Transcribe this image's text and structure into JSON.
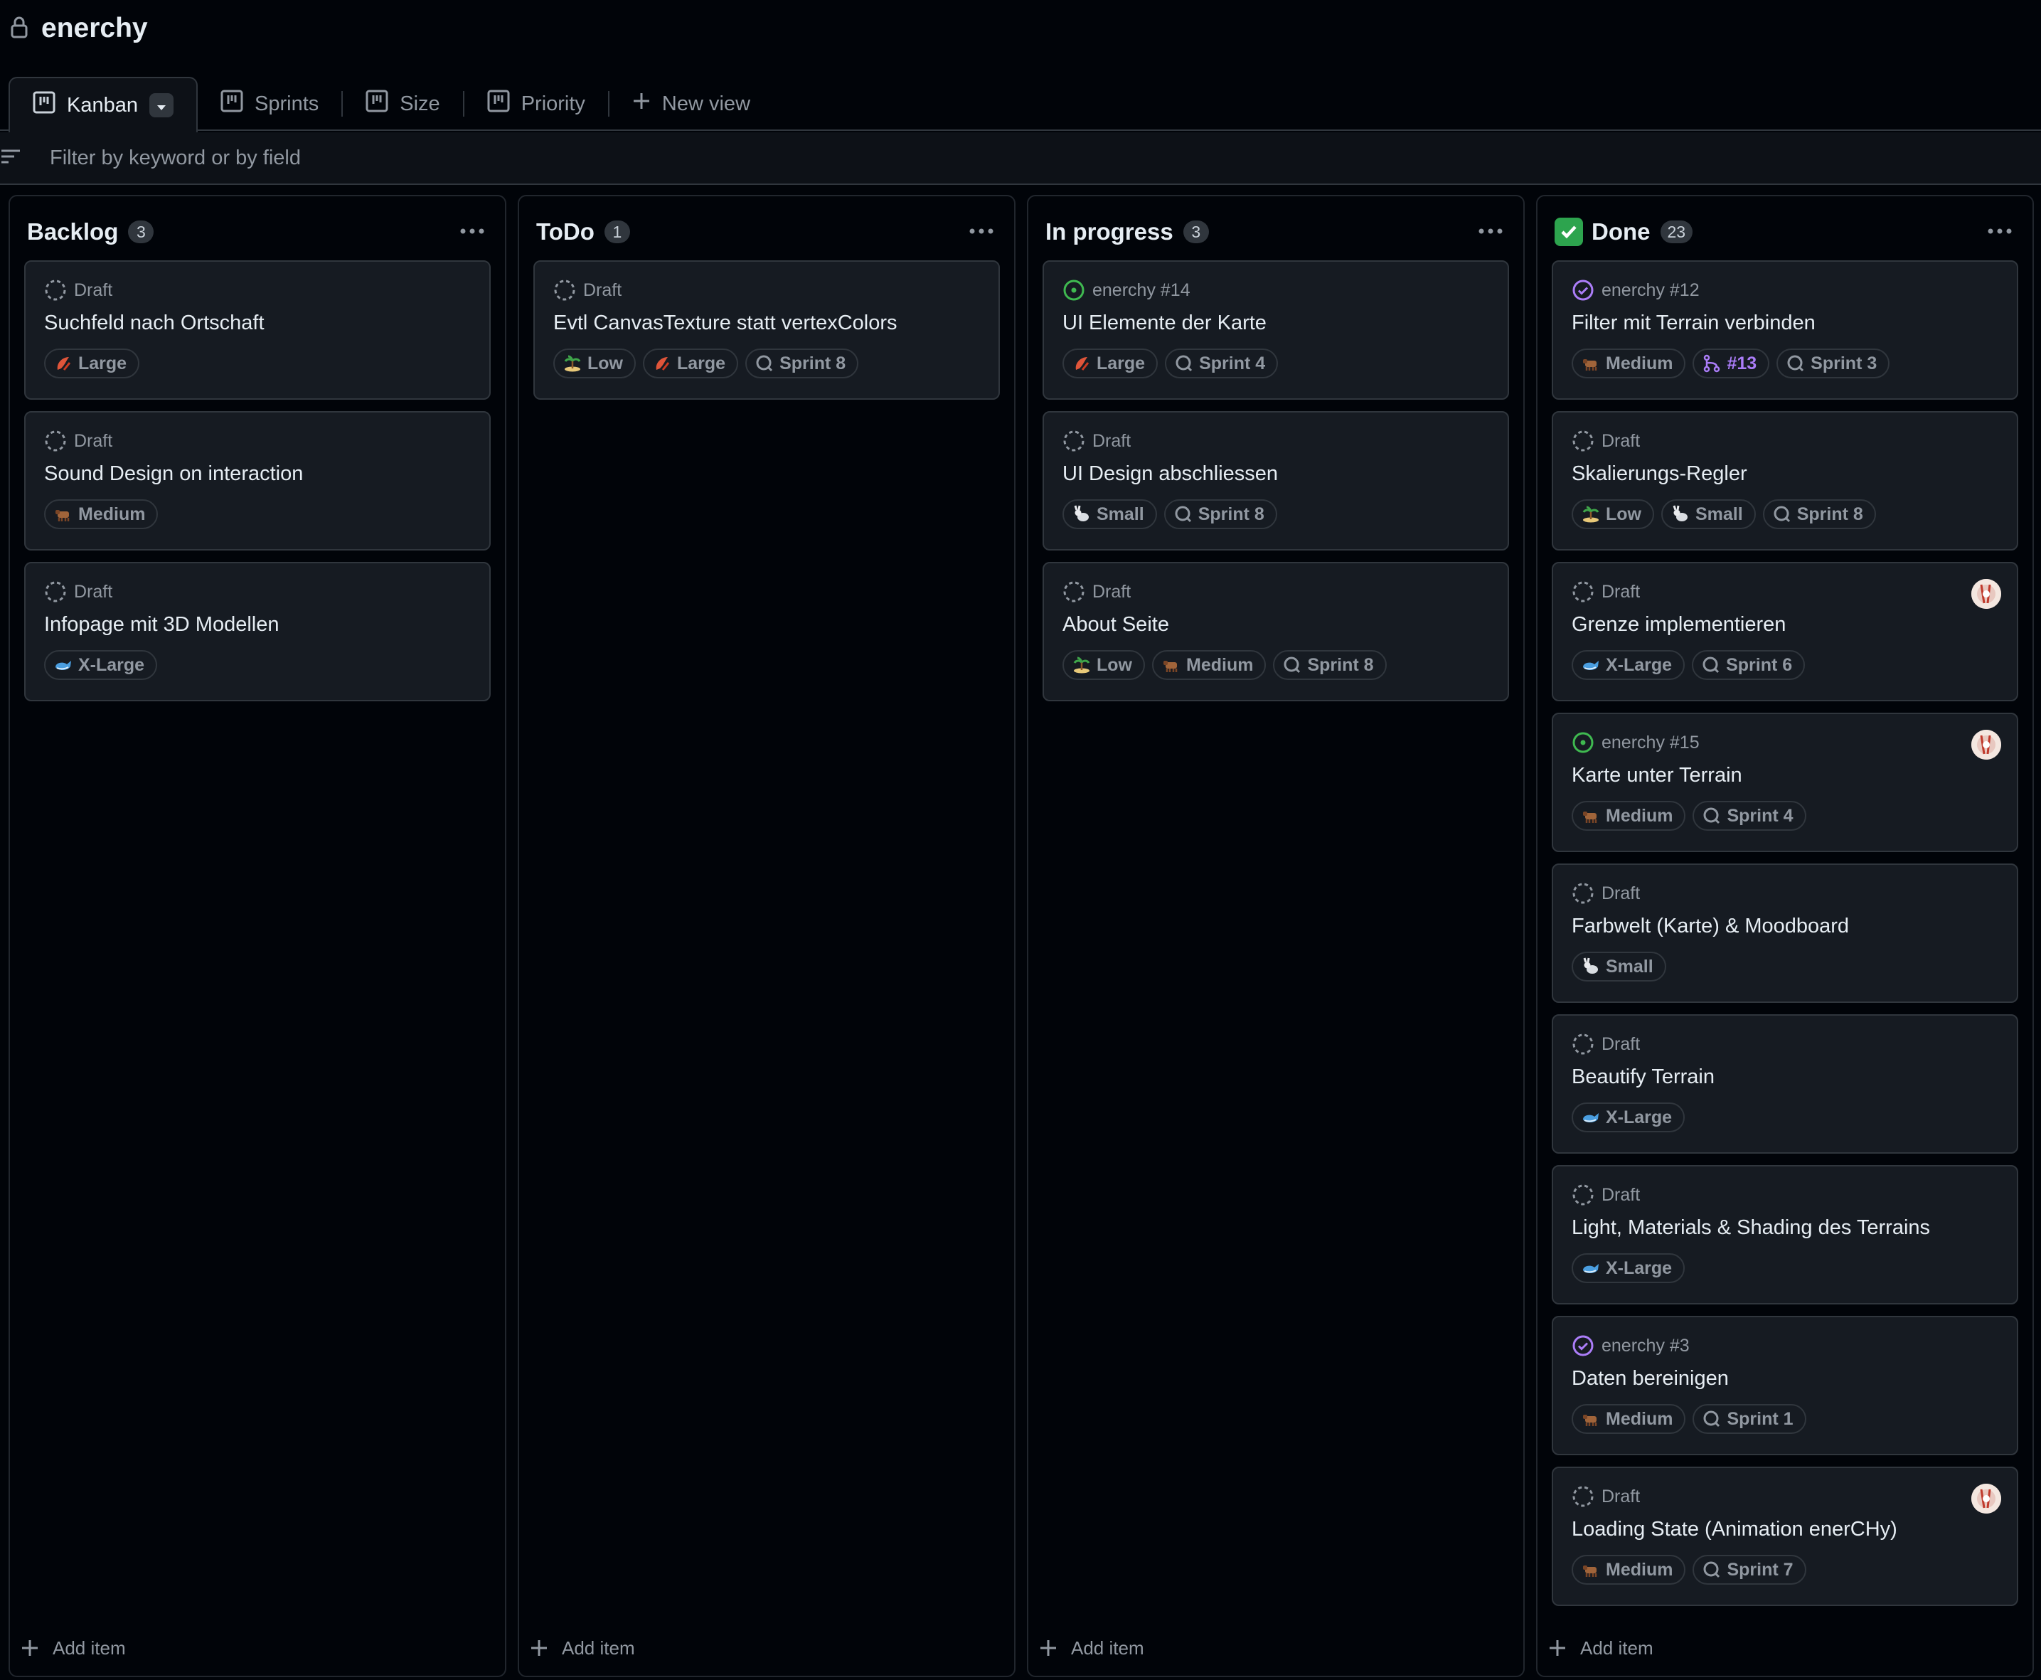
{
  "project": {
    "title": "enerchy"
  },
  "tabs": [
    {
      "label": "Kanban",
      "active": true
    },
    {
      "label": "Sprints"
    },
    {
      "label": "Size"
    },
    {
      "label": "Priority"
    },
    {
      "label": "New view"
    }
  ],
  "filter": {
    "placeholder": "Filter by keyword or by field"
  },
  "columns": [
    {
      "title": "Backlog",
      "count": "3",
      "add_label": "Add item",
      "cards": [
        {
          "meta": "Draft",
          "status": "draft",
          "title": "Suchfeld nach Ortschaft",
          "labels": [
            {
              "icon": "lobster",
              "text": "Large"
            }
          ]
        },
        {
          "meta": "Draft",
          "status": "draft",
          "title": "Sound Design on interaction",
          "labels": [
            {
              "icon": "ox",
              "text": "Medium"
            }
          ]
        },
        {
          "meta": "Draft",
          "status": "draft",
          "title": "Infopage mit 3D Modellen",
          "labels": [
            {
              "icon": "whale",
              "text": "X-Large"
            }
          ]
        }
      ]
    },
    {
      "title": "ToDo",
      "count": "1",
      "add_label": "Add item",
      "cards": [
        {
          "meta": "Draft",
          "status": "draft",
          "title": "Evtl CanvasTexture statt vertexColors",
          "labels": [
            {
              "icon": "island",
              "text": "Low"
            },
            {
              "icon": "lobster",
              "text": "Large"
            },
            {
              "icon": "iteration",
              "text": "Sprint 8"
            }
          ]
        }
      ]
    },
    {
      "title": "In progress",
      "count": "3",
      "add_label": "Add item",
      "cards": [
        {
          "meta": "enerchy #14",
          "status": "open",
          "title": "UI Elemente der Karte",
          "labels": [
            {
              "icon": "lobster",
              "text": "Large"
            },
            {
              "icon": "iteration",
              "text": "Sprint 4"
            }
          ]
        },
        {
          "meta": "Draft",
          "status": "draft",
          "title": "UI Design abschliessen",
          "labels": [
            {
              "icon": "rabbit",
              "text": "Small"
            },
            {
              "icon": "iteration",
              "text": "Sprint 8"
            }
          ]
        },
        {
          "meta": "Draft",
          "status": "draft",
          "title": "About Seite",
          "labels": [
            {
              "icon": "island",
              "text": "Low"
            },
            {
              "icon": "ox",
              "text": "Medium"
            },
            {
              "icon": "iteration",
              "text": "Sprint 8"
            }
          ]
        }
      ]
    },
    {
      "title": "Done",
      "count": "23",
      "add_label": "Add item",
      "done_icon": true,
      "cards": [
        {
          "meta": "enerchy #12",
          "status": "closed",
          "title": "Filter mit Terrain verbinden",
          "labels": [
            {
              "icon": "ox",
              "text": "Medium"
            },
            {
              "icon": "pull-request",
              "text": "#13"
            },
            {
              "icon": "iteration",
              "text": "Sprint 3"
            }
          ]
        },
        {
          "meta": "Draft",
          "status": "draft",
          "title": "Skalierungs-Regler",
          "labels": [
            {
              "icon": "island",
              "text": "Low"
            },
            {
              "icon": "rabbit",
              "text": "Small"
            },
            {
              "icon": "iteration",
              "text": "Sprint 8"
            }
          ]
        },
        {
          "meta": "Draft",
          "status": "draft",
          "title": "Grenze implementieren",
          "avatar": true,
          "labels": [
            {
              "icon": "whale",
              "text": "X-Large"
            },
            {
              "icon": "iteration",
              "text": "Sprint 6"
            }
          ]
        },
        {
          "meta": "enerchy #15",
          "status": "open",
          "title": "Karte unter Terrain",
          "avatar": true,
          "labels": [
            {
              "icon": "ox",
              "text": "Medium"
            },
            {
              "icon": "iteration",
              "text": "Sprint 4"
            }
          ]
        },
        {
          "meta": "Draft",
          "status": "draft",
          "title": "Farbwelt (Karte) & Moodboard",
          "labels": [
            {
              "icon": "rabbit",
              "text": "Small"
            }
          ]
        },
        {
          "meta": "Draft",
          "status": "draft",
          "title": "Beautify Terrain",
          "labels": [
            {
              "icon": "whale",
              "text": "X-Large"
            }
          ]
        },
        {
          "meta": "Draft",
          "status": "draft",
          "title": "Light, Materials & Shading des Terrains",
          "labels": [
            {
              "icon": "whale",
              "text": "X-Large"
            }
          ]
        },
        {
          "meta": "enerchy #3",
          "status": "closed",
          "title": "Daten bereinigen",
          "labels": [
            {
              "icon": "ox",
              "text": "Medium"
            },
            {
              "icon": "iteration",
              "text": "Sprint 1"
            }
          ]
        },
        {
          "meta": "Draft",
          "status": "draft",
          "title": "Loading State (Animation enerCHy)",
          "avatar": true,
          "labels": [
            {
              "icon": "ox",
              "text": "Medium"
            },
            {
              "icon": "iteration",
              "text": "Sprint 7"
            }
          ]
        }
      ]
    }
  ]
}
